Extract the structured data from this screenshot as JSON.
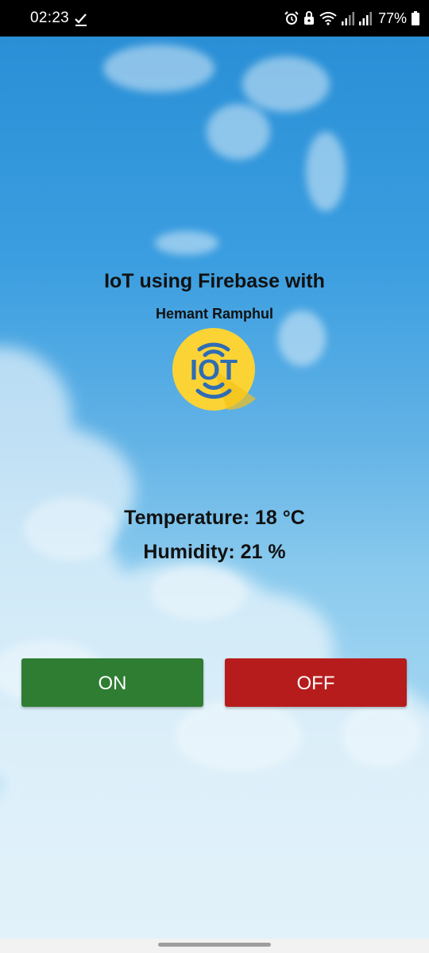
{
  "status_bar": {
    "time": "02:23",
    "battery_percent": "77%",
    "icons": [
      "task-done-icon",
      "alarm-icon",
      "lock-icon",
      "wifi-icon",
      "signal-icon",
      "signal-icon",
      "battery-icon"
    ]
  },
  "app": {
    "title": "IoT using Firebase with",
    "author": "Hemant Ramphul",
    "logo_text": "IOT",
    "temperature_line": "Temperature: 18 °C",
    "humidity_line": "Humidity: 21 %"
  },
  "controls": {
    "on_label": "ON",
    "off_label": "OFF"
  },
  "colors": {
    "on_button": "#2e7d32",
    "off_button": "#b71c1c",
    "logo_circle": "#fcd335",
    "logo_text": "#2f6cb4",
    "sky": "#2a8fd6"
  }
}
